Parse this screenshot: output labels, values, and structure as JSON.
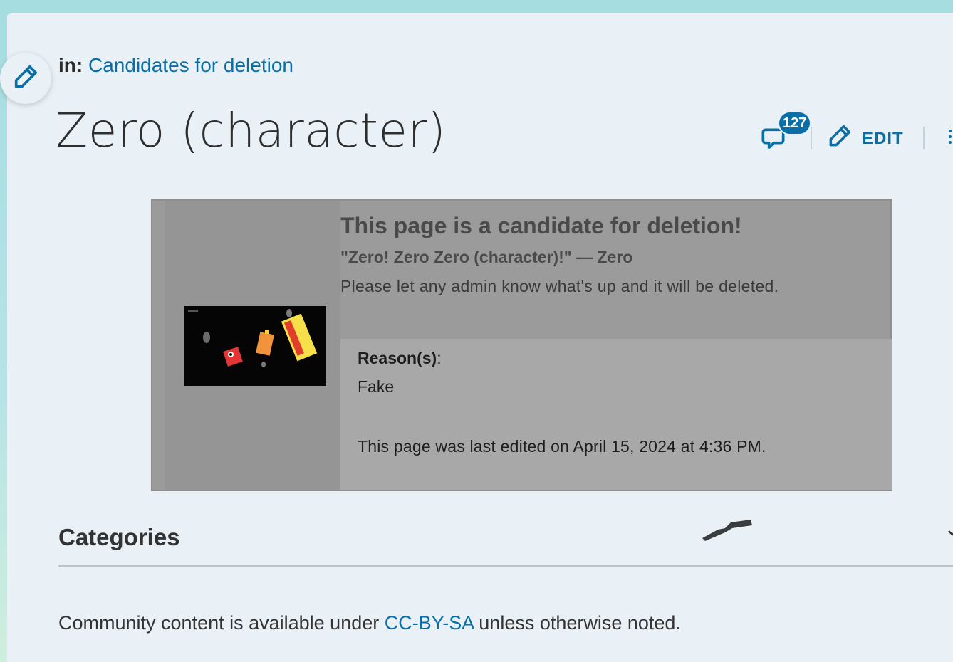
{
  "breadcrumb": {
    "prefix": "in:",
    "category": "Candidates for deletion"
  },
  "page": {
    "title": "Zero (character)"
  },
  "actions": {
    "comment_count": "127",
    "edit_label": "EDIT"
  },
  "notice": {
    "heading": "This page is a candidate for deletion!",
    "quote": "\"Zero! Zero Zero (character)!\" — Zero",
    "plea": "Please let any admin know what's up and it will be deleted.",
    "reason_label": "Reason(s)",
    "reason_colon": ":",
    "reason_value": "Fake",
    "last_edited": "This page was last edited on April 15, 2024 at 4:36 PM."
  },
  "categories": {
    "heading": "Categories"
  },
  "footer": {
    "license_prefix": "Community content is available under ",
    "license_link": "CC-BY-SA",
    "license_suffix": " unless otherwise noted."
  },
  "colors": {
    "link": "#0a6fa6",
    "notice_bg": "#9b9b9b",
    "reason_bg": "#a8a8a8",
    "page_bg": "#e9f1f6"
  },
  "icons": [
    "pencil-icon",
    "comment-icon",
    "kebab-menu-icon",
    "chevron-down-icon"
  ]
}
